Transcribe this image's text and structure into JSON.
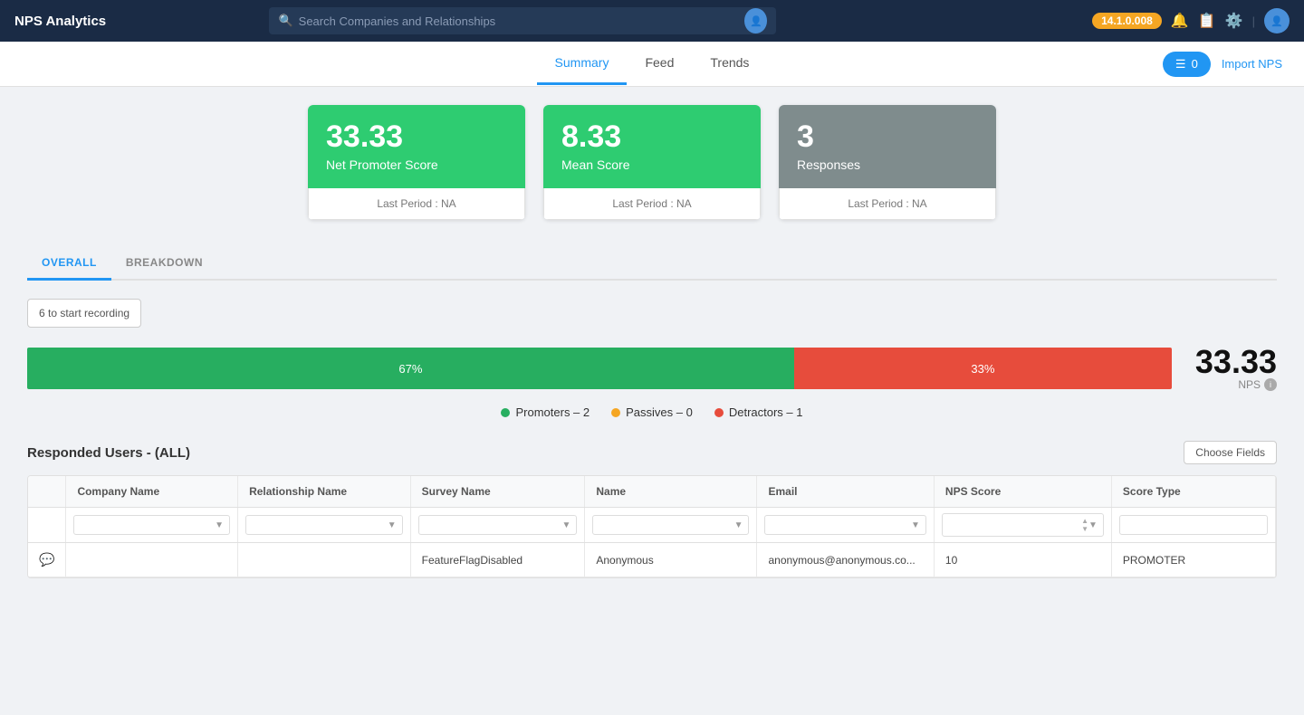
{
  "app": {
    "title": "NPS Analytics",
    "version": "14.1.0.008"
  },
  "search": {
    "placeholder": "Search Companies and Relationships"
  },
  "nav": {
    "tabs": [
      {
        "id": "summary",
        "label": "Summary",
        "active": true
      },
      {
        "id": "feed",
        "label": "Feed",
        "active": false
      },
      {
        "id": "trends",
        "label": "Trends",
        "active": false
      }
    ],
    "actions": {
      "queue_label": "0",
      "import_label": "Import NPS"
    }
  },
  "metrics": [
    {
      "id": "nps",
      "big_number": "33.33",
      "label": "Net Promoter Score",
      "last_period": "Last Period : NA",
      "color": "green"
    },
    {
      "id": "mean",
      "big_number": "8.33",
      "label": "Mean Score",
      "last_period": "Last Period : NA",
      "color": "green"
    },
    {
      "id": "responses",
      "big_number": "3",
      "label": "Responses",
      "last_period": "Last Period : NA",
      "color": "gray"
    }
  ],
  "section_tabs": [
    {
      "id": "overall",
      "label": "OVERALL",
      "active": true
    },
    {
      "id": "breakdown",
      "label": "BREAKDOWN",
      "active": false
    }
  ],
  "tooltip_hint": "6 to start recording",
  "nps_bar": {
    "green_pct": 67,
    "green_label": "67%",
    "red_pct": 33,
    "red_label": "33%",
    "score": "33.33",
    "score_label": "NPS"
  },
  "legend": [
    {
      "id": "promoters",
      "label": "Promoters",
      "count": "2",
      "color": "#27ae60"
    },
    {
      "id": "passives",
      "label": "Passives",
      "count": "0",
      "color": "#f5a623"
    },
    {
      "id": "detractors",
      "label": "Detractors",
      "count": "1",
      "color": "#e74c3c"
    }
  ],
  "responded_users": {
    "title": "Responded Users - (ALL)",
    "choose_fields_label": "Choose Fields"
  },
  "table": {
    "columns": [
      {
        "id": "company_name",
        "label": "Company Name"
      },
      {
        "id": "relationship_name",
        "label": "Relationship Name"
      },
      {
        "id": "survey_name",
        "label": "Survey Name"
      },
      {
        "id": "name",
        "label": "Name"
      },
      {
        "id": "email",
        "label": "Email"
      },
      {
        "id": "nps_score",
        "label": "NPS Score"
      },
      {
        "id": "score_type",
        "label": "Score Type"
      }
    ],
    "rows": [
      {
        "company_name": "",
        "relationship_name": "",
        "survey_name": "FeatureFlagDisabled",
        "name": "Anonymous",
        "email": "anonymous@anonymous.co...",
        "nps_score": "10",
        "score_type": "PROMOTER",
        "has_icon": true
      }
    ]
  }
}
